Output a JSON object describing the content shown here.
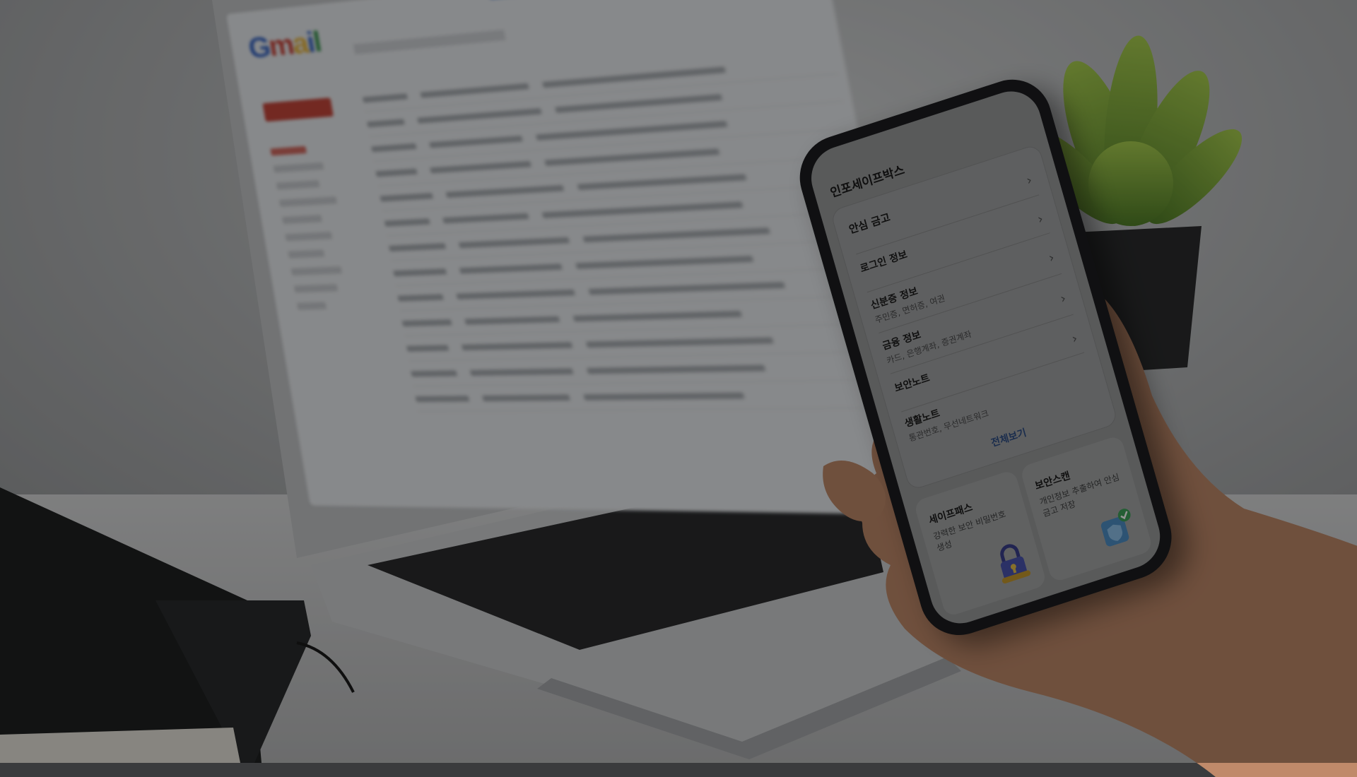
{
  "scene": {
    "description_objects": [
      "laptop",
      "smartphone",
      "hand",
      "plant",
      "notebook"
    ]
  },
  "laptop": {
    "logo_text": "Gmail"
  },
  "phone_app": {
    "title": "인포세이프박스",
    "safe_box": {
      "heading": "안심 금고",
      "items": [
        {
          "label": "로그인 정보",
          "sub": ""
        },
        {
          "label": "신분증 정보",
          "sub": "주민증, 면허증, 여권"
        },
        {
          "label": "금융 정보",
          "sub": "카드, 은행계좌, 증권계좌"
        },
        {
          "label": "보안노트",
          "sub": ""
        },
        {
          "label": "생활노트",
          "sub": "통관번호, 무선네트워크"
        }
      ],
      "view_all": "전체보기"
    },
    "tiles": [
      {
        "title": "세이프패스",
        "desc": "강력한 보안 비밀번호 생성",
        "icon": "padlock-icon"
      },
      {
        "title": "보안스캔",
        "desc": "개인정보 추출하여 안심금고 저장",
        "icon": "shield-check-icon"
      }
    ],
    "accent_color": "#2f4f86"
  }
}
